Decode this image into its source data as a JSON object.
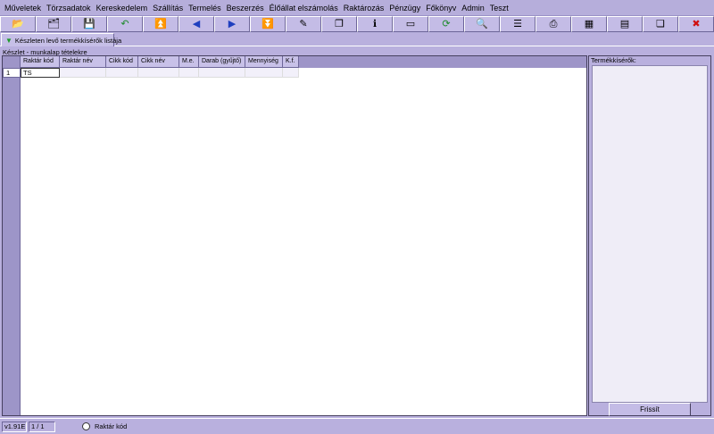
{
  "menu": [
    "Műveletek",
    "Törzsadatok",
    "Kereskedelem",
    "Szállítás",
    "Termelés",
    "Beszerzés",
    "Élőállat elszámolás",
    "Raktározás",
    "Pénzügy",
    "Főkönyv",
    "Admin",
    "Teszt"
  ],
  "toolbar": [
    {
      "icon": "open-folder-icon",
      "glyph": "📂"
    },
    {
      "icon": "folder-icon",
      "glyph": "🗂"
    },
    {
      "icon": "save-icon",
      "glyph": "💾"
    },
    {
      "icon": "undo-icon",
      "glyph": "↶"
    },
    {
      "icon": "first-record-icon",
      "glyph": "⏫"
    },
    {
      "icon": "previous-record-icon",
      "glyph": "◀"
    },
    {
      "icon": "next-record-icon",
      "glyph": "▶"
    },
    {
      "icon": "last-record-icon",
      "glyph": "⏬"
    },
    {
      "icon": "edit-icon",
      "glyph": "✎"
    },
    {
      "icon": "copy-icon",
      "glyph": "❐"
    },
    {
      "icon": "info-icon",
      "glyph": "ℹ"
    },
    {
      "icon": "window-icon",
      "glyph": "▭"
    },
    {
      "icon": "refresh-icon",
      "glyph": "⟳"
    },
    {
      "icon": "search-icon",
      "glyph": "🔍"
    },
    {
      "icon": "list-icon",
      "glyph": "☰"
    },
    {
      "icon": "print-icon",
      "glyph": "⎙"
    },
    {
      "icon": "grid-icon",
      "glyph": "▦"
    },
    {
      "icon": "table-icon",
      "glyph": "▤"
    },
    {
      "icon": "restore-window-icon",
      "glyph": "❏"
    },
    {
      "icon": "close-icon",
      "glyph": "✖"
    }
  ],
  "tab": {
    "label": "Készleten levő termékkísérők listája"
  },
  "left_panel": {
    "caption": "Készlet - munkalap tételekre",
    "columns": [
      "Raktár kód",
      "Raktár név",
      "Cikk kód",
      "Cikk név",
      "M.e.",
      "Darab (gyűjtő)",
      "Mennyiség",
      "K.f."
    ],
    "rows": [
      {
        "num": "1",
        "cells": [
          "TS",
          "",
          "",
          "",
          "",
          "",
          "",
          ""
        ]
      }
    ]
  },
  "right_panel": {
    "title": "Termékkísérők:",
    "refresh_label": "Frissít"
  },
  "statusbar": {
    "version": "v1.91E",
    "page": "1 / 1",
    "radio_label": "Raktár kód"
  }
}
